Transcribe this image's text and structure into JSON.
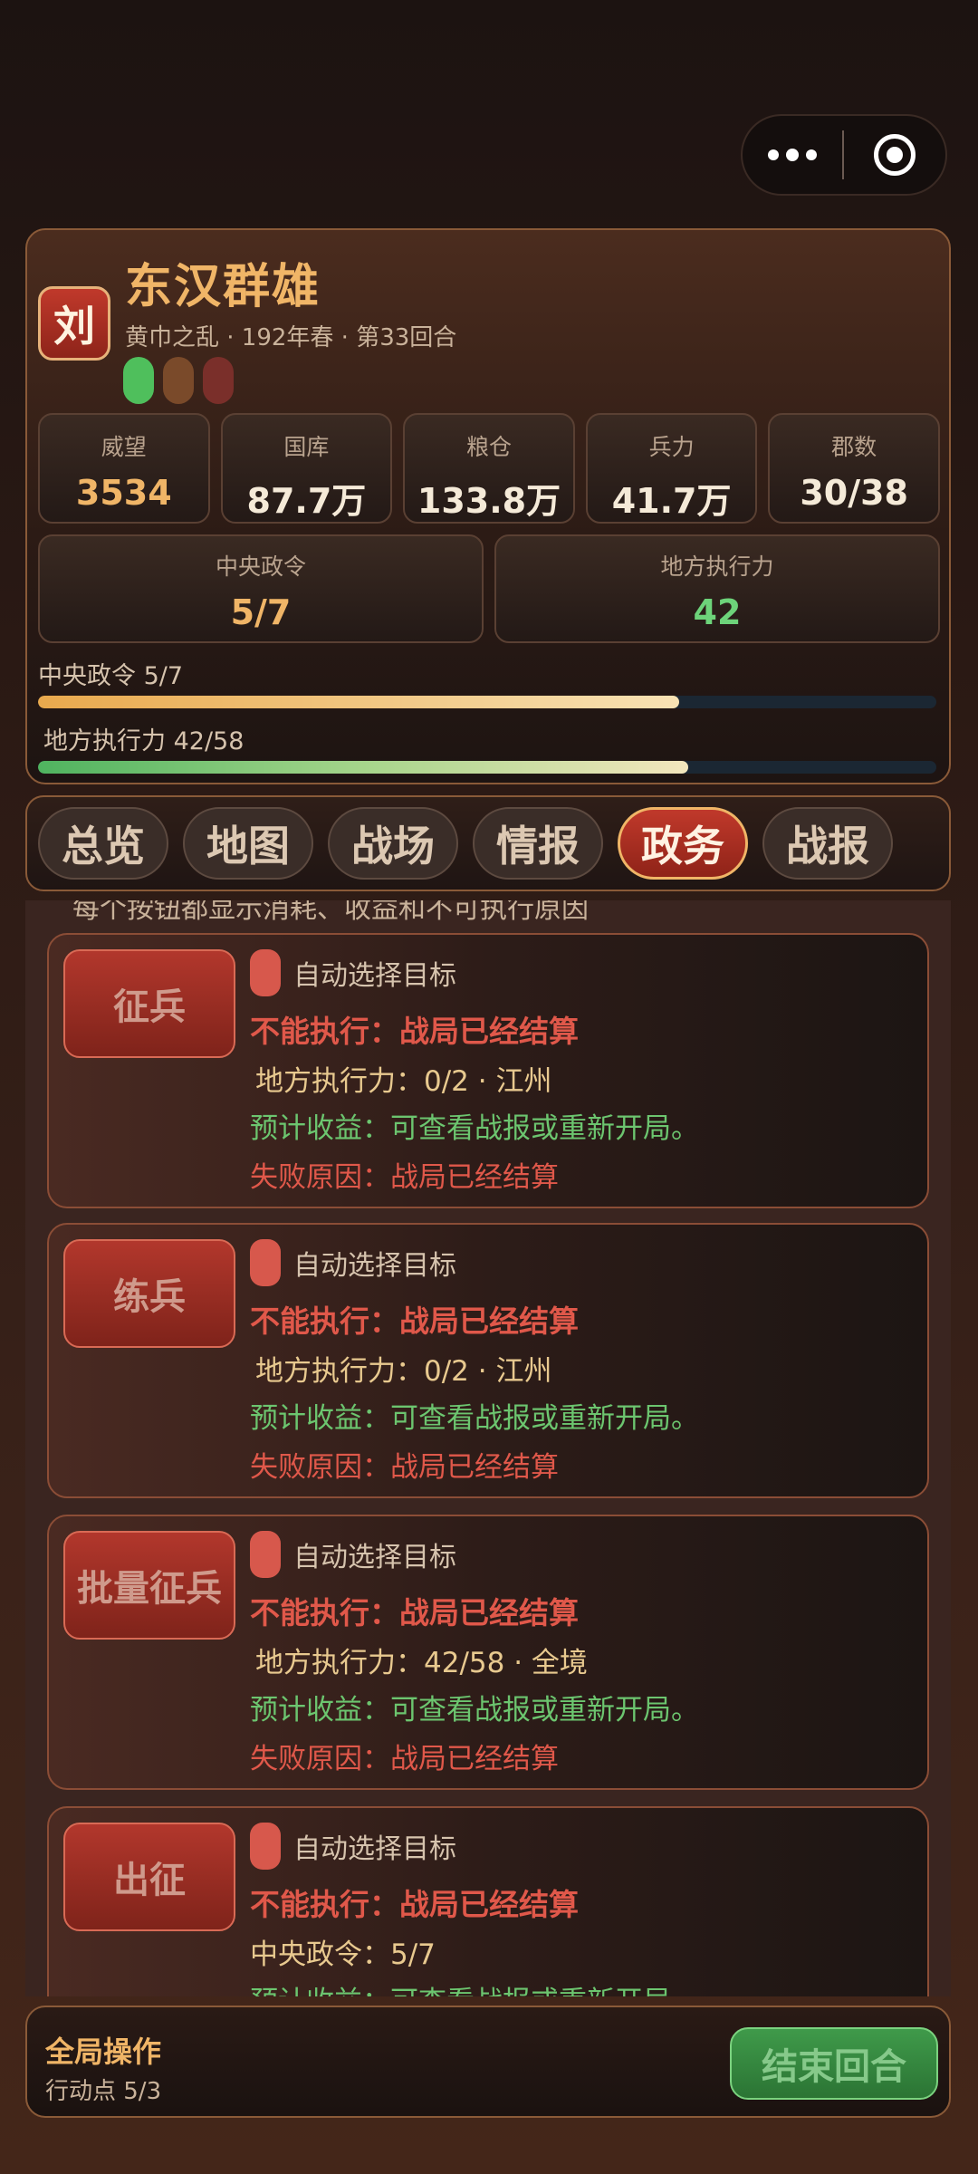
{
  "header": {
    "seal": "刘",
    "title": "东汉群雄",
    "subtitle": "黄巾之乱 · 192年春 · 第33回合",
    "pills": [
      "#4fbf5c",
      "#7a4a2a",
      "#7a2f2a"
    ]
  },
  "stats": [
    {
      "label": "威望",
      "value": "3534"
    },
    {
      "label": "国库",
      "value": "87.7万"
    },
    {
      "label": "粮仓",
      "value": "133.8万"
    },
    {
      "label": "兵力",
      "value": "41.7万"
    },
    {
      "label": "郡数",
      "value": "30/38"
    }
  ],
  "stats2": [
    {
      "label": "中央政令",
      "value": "5/7"
    },
    {
      "label": "地方执行力",
      "value": "42"
    }
  ],
  "bars": [
    {
      "label": "中央政令  5/7",
      "fraction": 0.714
    },
    {
      "label": "地方执行力  42/58",
      "fraction": 0.724
    }
  ],
  "tabs": [
    "总览",
    "地图",
    "战场",
    "情报",
    "政务",
    "战报"
  ],
  "active_tab": "政务",
  "cut_text": "每个按钮都显示消耗、收益和不可执行原因",
  "actions": [
    {
      "button": "征兵",
      "toggle_label": "自动选择目标",
      "status": "不能执行：战局已经结算",
      "cost": "地方执行力：0/2 · 江州",
      "benefit": "预计收益：可查看战报或重新开局。",
      "fail": "失败原因：战局已经结算"
    },
    {
      "button": "练兵",
      "toggle_label": "自动选择目标",
      "status": "不能执行：战局已经结算",
      "cost": "地方执行力：0/2 · 江州",
      "benefit": "预计收益：可查看战报或重新开局。",
      "fail": "失败原因：战局已经结算"
    },
    {
      "button": "批量征兵",
      "toggle_label": "自动选择目标",
      "status": "不能执行：战局已经结算",
      "cost": "地方执行力：42/58 · 全境",
      "benefit": "预计收益：可查看战报或重新开局。",
      "fail": "失败原因：战局已经结算"
    },
    {
      "button": "出征",
      "toggle_label": "自动选择目标",
      "status": "不能执行：战局已经结算",
      "cost": "中央政令：5/7",
      "benefit": "预计收益：可查看战报或重新开局。",
      "fail": ""
    }
  ],
  "footer": {
    "title": "全局操作",
    "sub": "行动点 5/3",
    "end_button": "结束回合"
  }
}
